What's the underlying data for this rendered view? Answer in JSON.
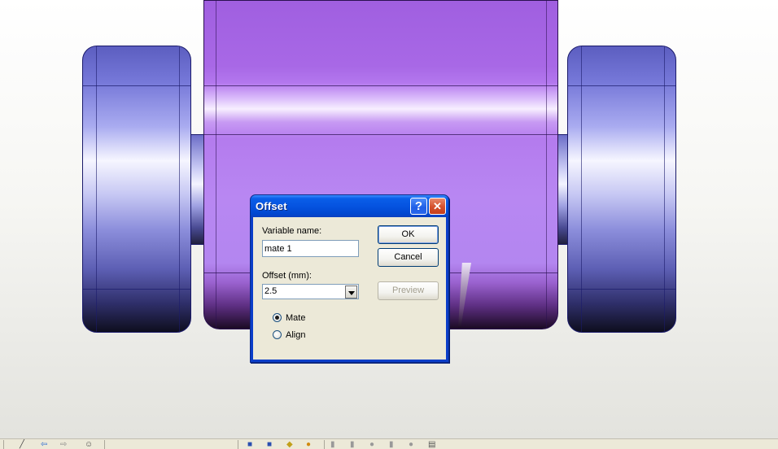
{
  "dialog": {
    "title": "Offset",
    "help_glyph": "?",
    "close_glyph": "✕",
    "variable_name_label": "Variable name:",
    "variable_name_value": "mate 1",
    "offset_label": "Offset (mm):",
    "offset_value": "2.5",
    "ok_label": "OK",
    "cancel_label": "Cancel",
    "preview_label": "Preview",
    "radio_mate_label": "Mate",
    "radio_align_label": "Align",
    "selected_radio": "Mate"
  },
  "toolbar": {
    "icons": [
      "sketch-line-icon",
      "back-arrow-icon",
      "forward-arrow-icon",
      "smiley-icon",
      "part-icon",
      "assembly-icon",
      "feature-icon",
      "shape-icon",
      "mirror-icon",
      "pattern-icon",
      "rotate-icon",
      "move-icon",
      "face-icon",
      "edge-icon"
    ]
  },
  "colors": {
    "titlebar": "#0553e0",
    "dialog_face": "#ece9d8",
    "body_purple": "#b47bee",
    "wheel_blue": "#7577d8"
  }
}
